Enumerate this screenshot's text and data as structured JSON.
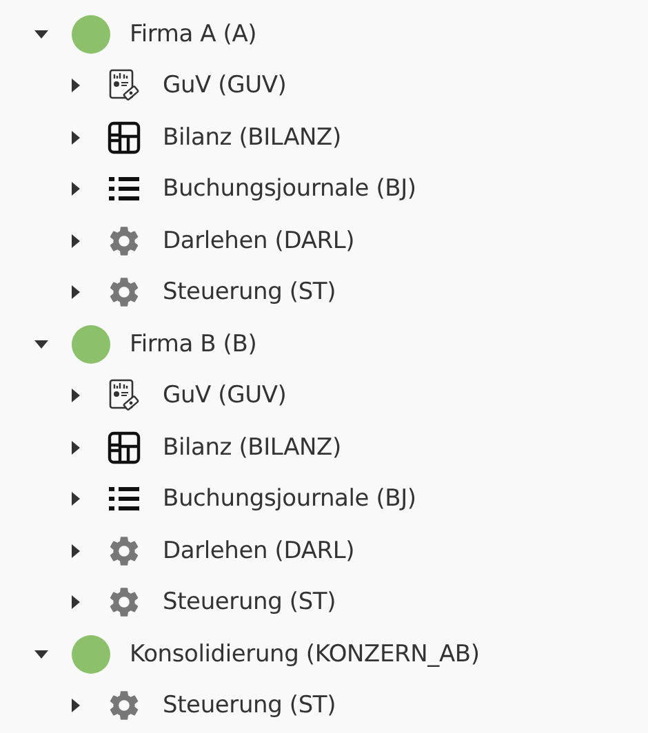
{
  "tree": [
    {
      "label": "Firma A (A)",
      "expanded": true,
      "color": "#8cc06a",
      "children": [
        {
          "label": "GuV (GUV)",
          "kind": "report",
          "expanded": false
        },
        {
          "label": "Bilanz (BILANZ)",
          "kind": "balance",
          "expanded": false
        },
        {
          "label": "Buchungsjournale (BJ)",
          "kind": "list",
          "expanded": false
        },
        {
          "label": "Darlehen (DARL)",
          "kind": "gear",
          "expanded": false
        },
        {
          "label": "Steuerung (ST)",
          "kind": "gear",
          "expanded": false
        }
      ]
    },
    {
      "label": "Firma B (B)",
      "expanded": true,
      "color": "#8cc06a",
      "children": [
        {
          "label": "GuV (GUV)",
          "kind": "report",
          "expanded": false
        },
        {
          "label": "Bilanz (BILANZ)",
          "kind": "balance",
          "expanded": false
        },
        {
          "label": "Buchungsjournale (BJ)",
          "kind": "list",
          "expanded": false
        },
        {
          "label": "Darlehen (DARL)",
          "kind": "gear",
          "expanded": false
        },
        {
          "label": "Steuerung (ST)",
          "kind": "gear",
          "expanded": false
        }
      ]
    },
    {
      "label": "Konsolidierung (KONZERN_AB)",
      "expanded": true,
      "color": "#8cc06a",
      "children": [
        {
          "label": "Steuerung (ST)",
          "kind": "gear",
          "expanded": false
        }
      ]
    }
  ]
}
